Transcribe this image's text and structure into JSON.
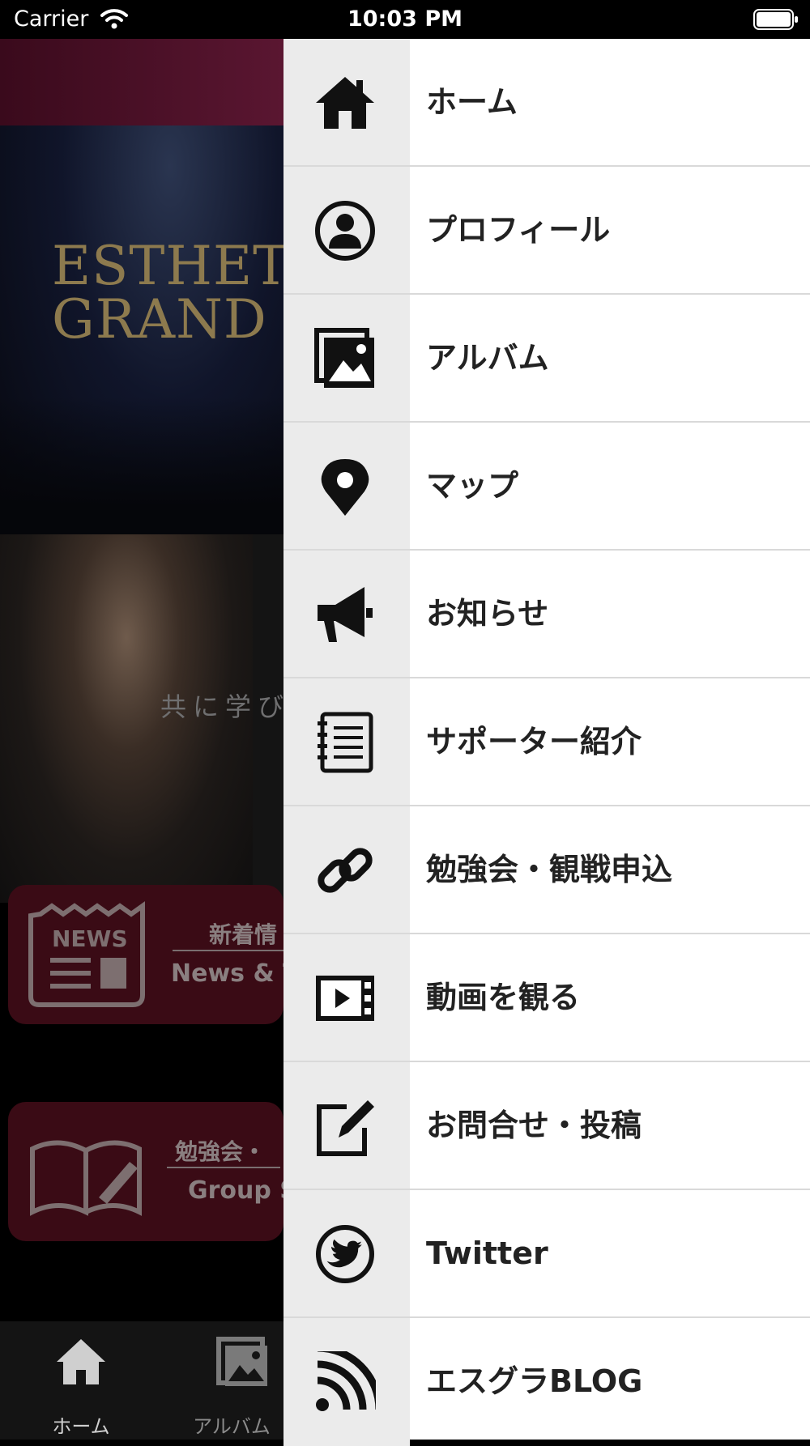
{
  "status_bar": {
    "carrier": "Carrier",
    "time": "10:03 PM"
  },
  "background": {
    "hero_title": "ESTHETIC\nGRAND P",
    "photo_caption": "共に学び",
    "news_card": {
      "title": "新着情",
      "subtitle": "News & T"
    },
    "study_card": {
      "title": "勉強会・",
      "subtitle": "Group S"
    },
    "tabbar": {
      "home_label": "ホーム",
      "album_label": "アルバム"
    }
  },
  "menu": {
    "items": [
      {
        "label": "ホーム",
        "icon": "home-icon"
      },
      {
        "label": "プロフィール",
        "icon": "profile-icon"
      },
      {
        "label": "アルバム",
        "icon": "album-icon"
      },
      {
        "label": "マップ",
        "icon": "map-pin-icon"
      },
      {
        "label": "お知らせ",
        "icon": "megaphone-icon"
      },
      {
        "label": "サポーター紹介",
        "icon": "notebook-icon"
      },
      {
        "label": "勉強会・観戦申込",
        "icon": "link-icon"
      },
      {
        "label": "動画を観る",
        "icon": "video-icon"
      },
      {
        "label": "お問合せ・投稿",
        "icon": "edit-icon"
      },
      {
        "label": "Twitter",
        "icon": "twitter-icon"
      },
      {
        "label": "エスグラBLOG",
        "icon": "rss-icon"
      }
    ]
  }
}
